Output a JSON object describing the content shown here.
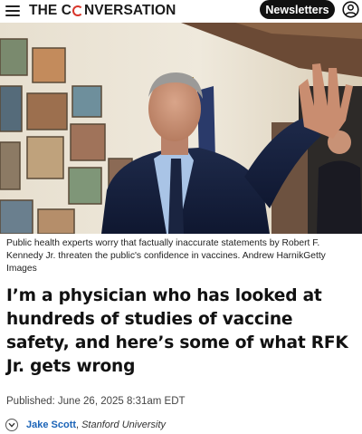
{
  "header": {
    "logo_pre": "THE C",
    "logo_post": "NVERSATION",
    "newsletters_label": "Newsletters",
    "icons": {
      "menu": "hamburger-menu-icon",
      "user": "user-account-icon"
    }
  },
  "hero": {
    "icon": "news-photo"
  },
  "caption": "Public health experts worry that factually inaccurate statements by Robert F. Kennedy Jr. threaten the public's confidence in vaccines. Andrew HarnikGetty Images",
  "headline": "I’m a physician who has looked at hundreds of studies of vaccine safety, and here’s some of what RFK Jr. gets wrong",
  "published": "Published: June 26, 2025 8:31am EDT",
  "author": {
    "name": "Jake Scott",
    "comma": ",",
    "affiliation": "Stanford University",
    "toggle_icon": "chevron-down-icon"
  },
  "colors": {
    "accent": "#d8352a",
    "author_link": "#1a63b7",
    "button_bg": "#111111"
  }
}
